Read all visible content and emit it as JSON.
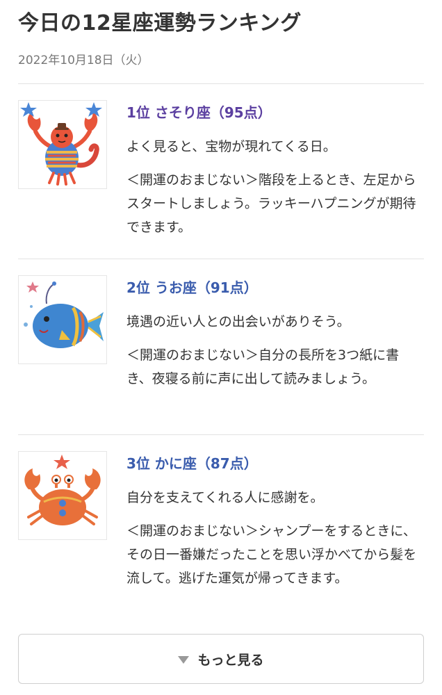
{
  "header": {
    "title": "今日の12星座運勢ランキング",
    "date": "2022年10月18日（火）"
  },
  "rankings": [
    {
      "title": "1位 さそり座（95点）",
      "summary": "よく見ると、宝物が現れてくる日。",
      "charm": "＜開運のおまじない＞階段を上るとき、左足からスタートしましょう。ラッキーハプニングが期待できます。",
      "title_color": "#5b3fa0",
      "icon": "scorpion-icon"
    },
    {
      "title": "2位 うお座（91点）",
      "summary": "境遇の近い人との出会いがありそう。",
      "charm": "＜開運のおまじない＞自分の長所を3つ紙に書き、夜寝る前に声に出して読みましょう。",
      "title_color": "#3a5cad",
      "icon": "fish-icon"
    },
    {
      "title": "3位 かに座（87点）",
      "summary": "自分を支えてくれる人に感謝を。",
      "charm": "＜開運のおまじない＞シャンプーをするときに、その日一番嫌だったことを思い浮かべてから髪を流して。逃げた運気が帰ってきます。",
      "title_color": "#3a5cad",
      "icon": "crab-icon"
    }
  ],
  "more_button": {
    "label": "もっと見る",
    "icon": "triangle-down-icon"
  }
}
